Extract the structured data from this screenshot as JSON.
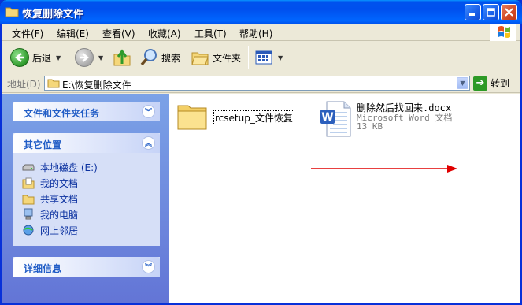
{
  "window": {
    "title": "恢复删除文件"
  },
  "menu": {
    "items": [
      "文件(F)",
      "编辑(E)",
      "查看(V)",
      "收藏(A)",
      "工具(T)",
      "帮助(H)"
    ]
  },
  "toolbar": {
    "back_label": "后退",
    "search_label": "搜索",
    "folders_label": "文件夹"
  },
  "address": {
    "label": "地址(D)",
    "value": "E:\\恢复删除文件",
    "go_label": "转到"
  },
  "taskpane": {
    "file_tasks_title": "文件和文件夹任务",
    "other_places_title": "其它位置",
    "other_places": [
      {
        "label": "本地磁盘 (E:)",
        "icon": "drive-icon"
      },
      {
        "label": "我的文档",
        "icon": "my-documents-icon"
      },
      {
        "label": "共享文档",
        "icon": "shared-documents-icon"
      },
      {
        "label": "我的电脑",
        "icon": "my-computer-icon"
      },
      {
        "label": "网上邻居",
        "icon": "network-icon"
      }
    ],
    "details_title": "详细信息"
  },
  "files": {
    "folder": {
      "name": "rcsetup_文件恢复"
    },
    "doc": {
      "name": "删除然后找回来.docx",
      "type": "Microsoft Word 文档",
      "size": "13 KB"
    }
  },
  "colors": {
    "title_bar": "#0053ee",
    "task_pane": "#7ba2e7",
    "panel_title": "#215dc6",
    "arrow": "#e00000"
  }
}
